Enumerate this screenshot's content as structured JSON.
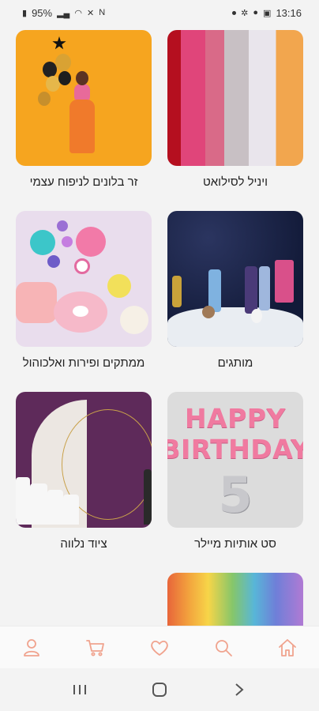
{
  "status_bar": {
    "battery": "95%",
    "time": "13:16"
  },
  "categories": [
    {
      "label": "ויניל לסילואט"
    },
    {
      "label": "זר בלונים לניפוח עצמי"
    },
    {
      "label": "מותגים"
    },
    {
      "label": "ממתקים ופירות ואלכוהול"
    },
    {
      "label": "סט אותיות מיילר"
    },
    {
      "label": "ציוד נלווה"
    },
    {
      "label": ""
    }
  ],
  "birthday_image_text": {
    "line1": "HAPPY",
    "line2": "BIRTHDAY",
    "number": "5"
  },
  "bottom_nav": {
    "items": [
      "home-icon",
      "search-icon",
      "heart-icon",
      "cart-icon",
      "user-icon"
    ],
    "accent_color": "#f0a38e"
  },
  "system_nav": {
    "items": [
      "back-icon",
      "home-button-icon",
      "recents-icon"
    ]
  }
}
